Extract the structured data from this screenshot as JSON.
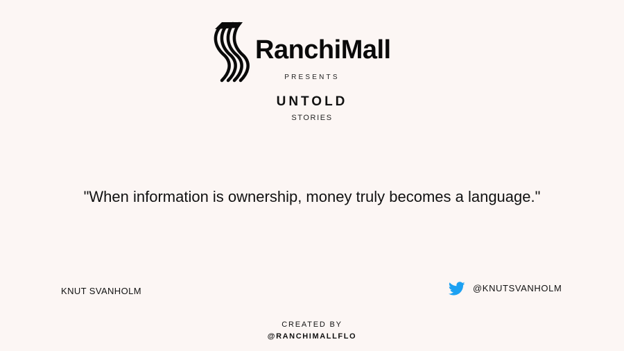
{
  "brand": {
    "name": "RanchiMall",
    "logo_icon": "ranchimall-logo-icon"
  },
  "header": {
    "presents": "PRESENTS",
    "title": "UNTOLD",
    "subtitle": "STORIES"
  },
  "quote": {
    "text": "\"When information is ownership, money truly becomes a language.\""
  },
  "author": {
    "name": "KNUT SVANHOLM",
    "twitter_icon": "twitter-bird-icon",
    "twitter_handle": "@KNUTSVANHOLM",
    "twitter_color": "#1da1f2"
  },
  "footer": {
    "created_by": "CREATED BY",
    "handle": "@RANCHIMALLFLO"
  },
  "colors": {
    "background": "#fcf6f4",
    "text": "#111111"
  }
}
